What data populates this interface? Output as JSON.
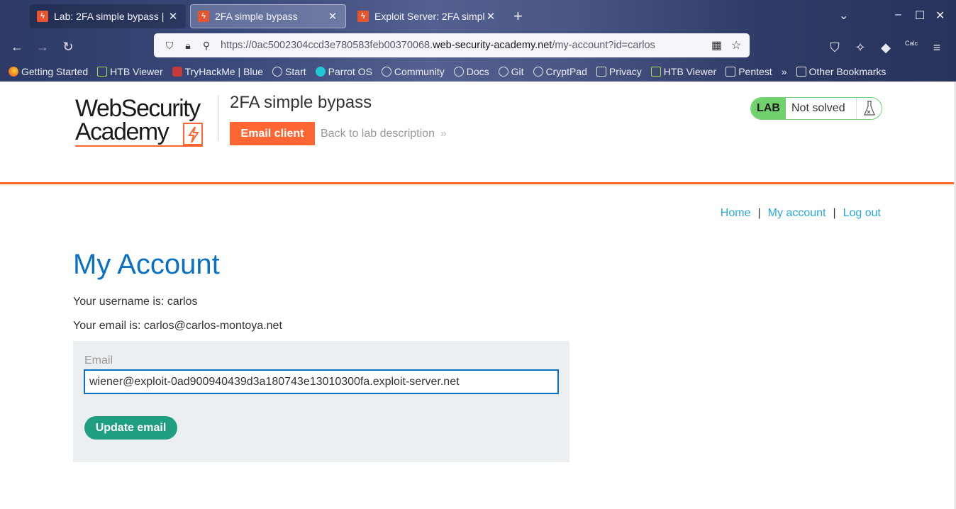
{
  "browser": {
    "tabs": [
      {
        "title": "Lab: 2FA simple bypass | ",
        "active": false
      },
      {
        "title": "2FA simple bypass",
        "active": true
      },
      {
        "title": "Exploit Server: 2FA simpl",
        "active": false
      }
    ],
    "url": {
      "prefix": "https://0ac5002304ccd3e780583feb00370068.",
      "domain": "web-security-academy.net",
      "path": "/my-account?id=carlos"
    },
    "bookmarks": [
      {
        "label": "Getting Started",
        "icon": "firefox-icon"
      },
      {
        "label": "HTB Viewer",
        "icon": "cube-icon"
      },
      {
        "label": "TryHackMe | Blue",
        "icon": "tryhackme-icon"
      },
      {
        "label": "Start",
        "icon": "globe-icon"
      },
      {
        "label": "Parrot OS",
        "icon": "parrot-icon"
      },
      {
        "label": "Community",
        "icon": "globe-icon"
      },
      {
        "label": "Docs",
        "icon": "globe-icon"
      },
      {
        "label": "Git",
        "icon": "globe-icon"
      },
      {
        "label": "CryptPad",
        "icon": "globe-icon"
      },
      {
        "label": "Privacy",
        "icon": "folder-icon"
      },
      {
        "label": "HTB Viewer",
        "icon": "cube-icon"
      },
      {
        "label": "Pentest",
        "icon": "folder-icon"
      }
    ],
    "overflow_bookmarks": "»",
    "other_bookmarks": "Other Bookmarks",
    "extension_badge": "Calc"
  },
  "header": {
    "logo_line1": "WebSecurity",
    "logo_line2": "Academy",
    "lab_title": "2FA simple bypass",
    "email_client": "Email client",
    "back_link": "Back to lab description",
    "back_chevron": "»",
    "lab_label": "LAB",
    "lab_status": "Not solved"
  },
  "nav": {
    "home": "Home",
    "my_account": "My account",
    "log_out": "Log out",
    "separator": "|"
  },
  "main": {
    "heading": "My Account",
    "username_line": "Your username is: carlos",
    "email_line": "Your email is: carlos@carlos-montoya.net",
    "form": {
      "label": "Email",
      "value": "wiener@exploit-0ad900940439d3a180743e13010300fa.exploit-server.net",
      "button": "Update email"
    }
  },
  "colors": {
    "accent_orange": "#ff6633",
    "heading_blue": "#0a71c1",
    "link_blue": "#29a9d8",
    "lab_green": "#70d16d",
    "button_teal": "#1f9f7f"
  }
}
